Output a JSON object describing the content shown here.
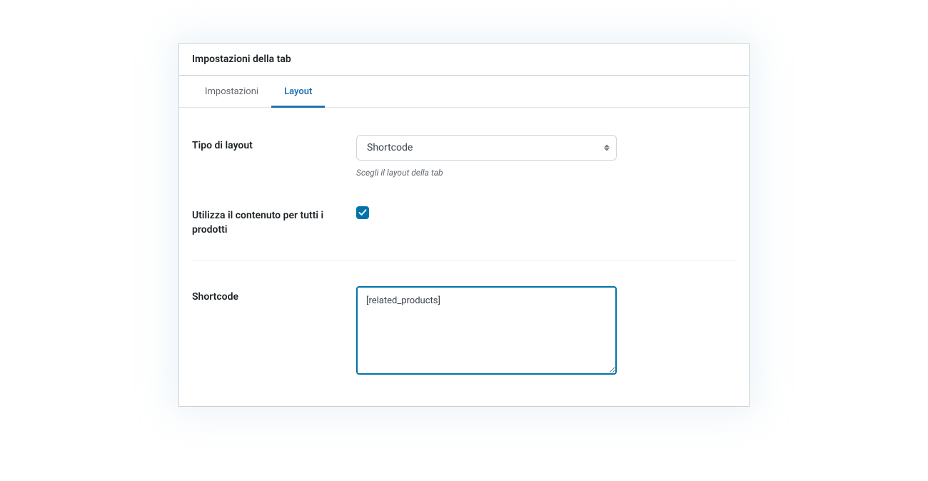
{
  "panel": {
    "title": "Impostazioni della tab"
  },
  "tabs": [
    {
      "label": "Impostazioni",
      "active": false
    },
    {
      "label": "Layout",
      "active": true
    }
  ],
  "fields": {
    "layoutType": {
      "label": "Tipo di layout",
      "value": "Shortcode",
      "help": "Scegli il layout della tab"
    },
    "useForAll": {
      "label": "Utilizza il contenuto per tutti i prodotti",
      "checked": true
    },
    "shortcode": {
      "label": "Shortcode",
      "value": "[related_products]"
    }
  }
}
